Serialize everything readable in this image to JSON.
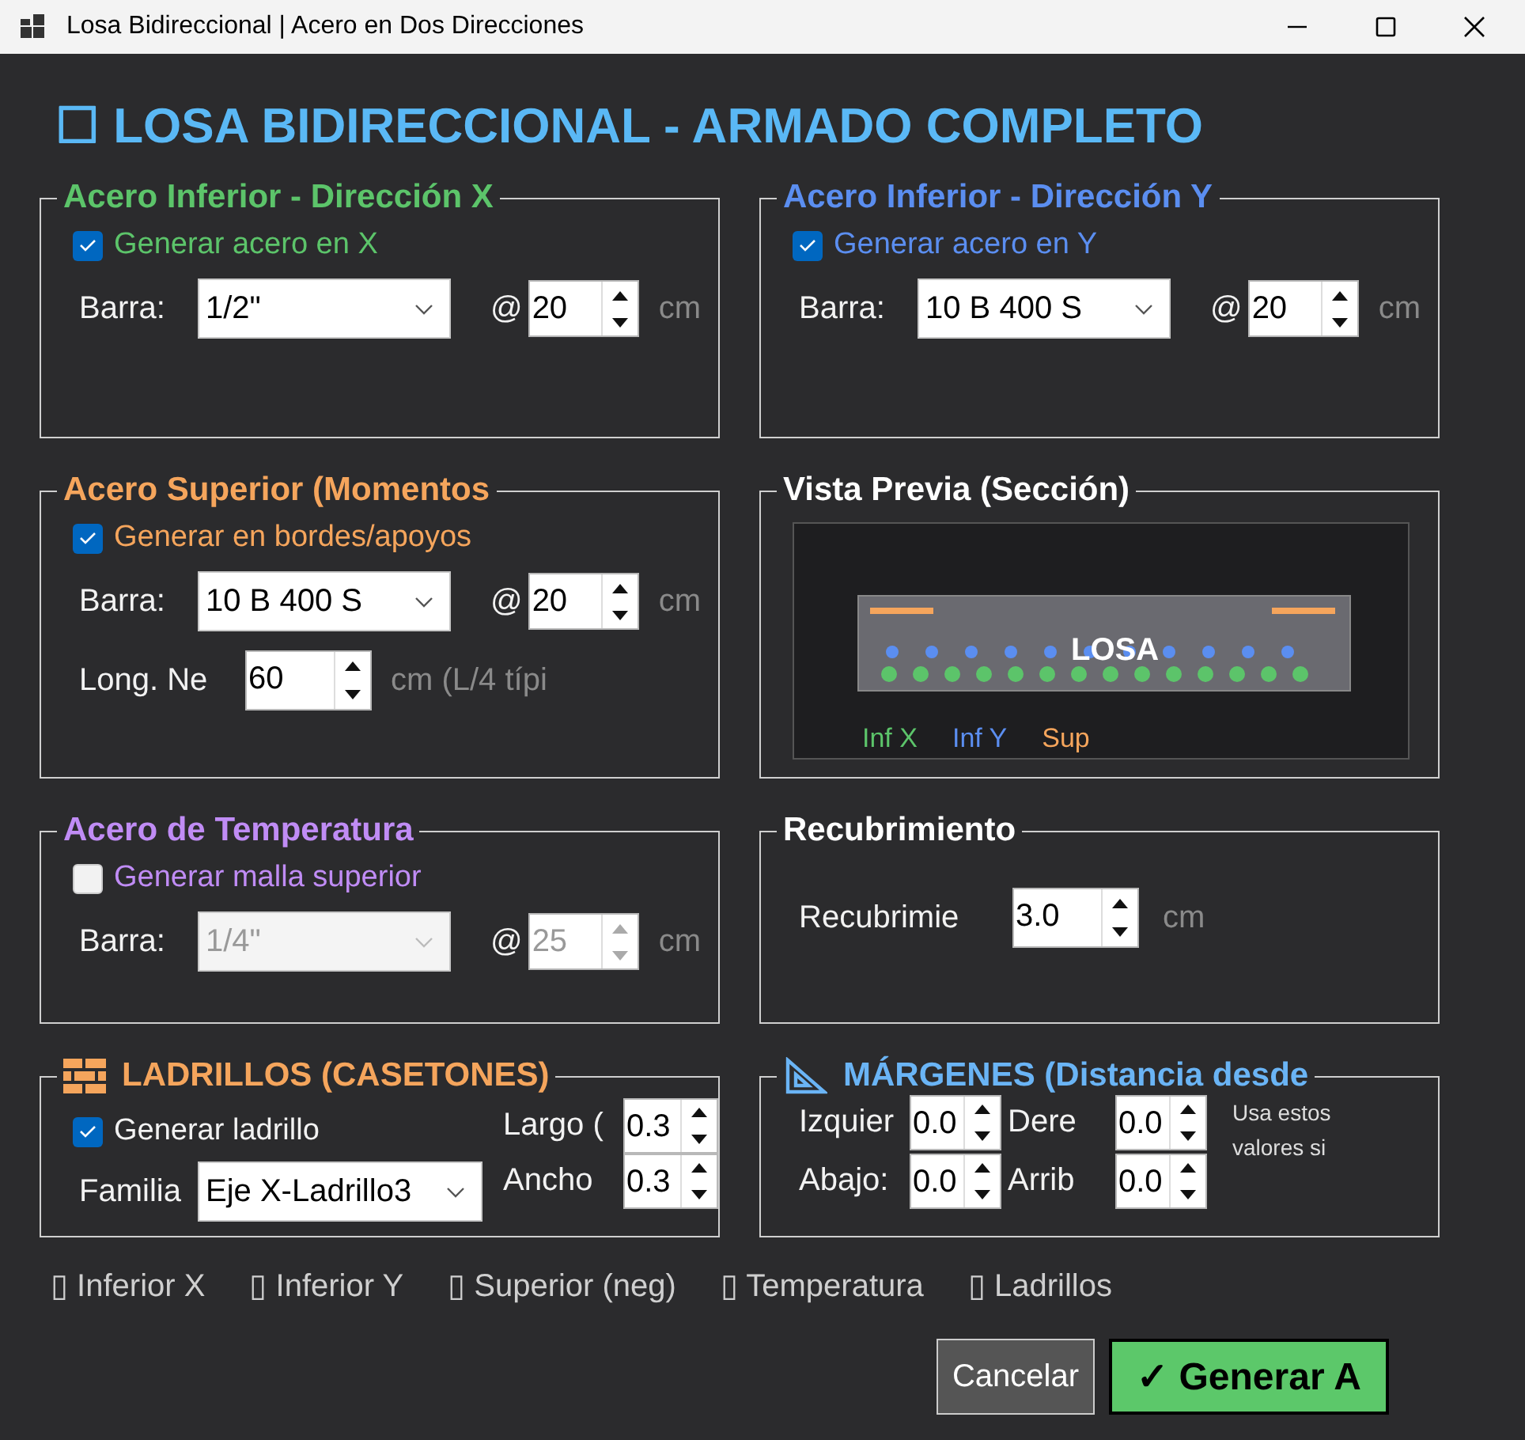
{
  "window": {
    "title": "Losa Bidireccional | Acero en Dos Direcciones"
  },
  "heading": "☐ LOSA BIDIRECCIONAL - ARMADO COMPLETO",
  "groups": [
    {
      "kind": "steel",
      "title": "Acero Inferior - Dirección X",
      "color": "#5cc46a",
      "checkbox": {
        "label": "Generar acero en X",
        "checked": true
      },
      "bar_label": "Barra:",
      "select": {
        "value": "1/2\"",
        "disabled": false
      },
      "at": "@",
      "spacing": {
        "value": "20",
        "disabled": false
      },
      "unit": "cm"
    },
    {
      "kind": "steel",
      "title": "Acero Inferior - Dirección Y",
      "color": "#5b8ef0",
      "checkbox": {
        "label": "Generar acero en Y",
        "checked": true
      },
      "bar_label": "Barra:",
      "select": {
        "value": "10 B 400 S",
        "disabled": false
      },
      "at": "@",
      "spacing": {
        "value": "20",
        "disabled": false
      },
      "unit": "cm"
    },
    {
      "kind": "steel",
      "title": "Acero Superior (Momentos",
      "color": "#f5a55c",
      "checkbox": {
        "label": "Generar en bordes/apoyos",
        "checked": true
      },
      "bar_label": "Barra:",
      "select": {
        "value": "10 B 400 S",
        "disabled": false
      },
      "at": "@",
      "spacing": {
        "value": "20",
        "disabled": false
      },
      "unit": "cm",
      "length": {
        "label": "Long. Ne",
        "value": "60",
        "unit": "cm (L/4 típi"
      }
    },
    {
      "kind": "preview",
      "title": "Vista Previa (Sección)",
      "color": "#ffffff",
      "slab_label": "LOSA",
      "legend": [
        {
          "label": "Inf X",
          "color": "#5cc46a"
        },
        {
          "label": "Inf Y",
          "color": "#5b8ef0"
        },
        {
          "label": "Sup",
          "color": "#f5a55c"
        }
      ]
    },
    {
      "kind": "steel",
      "title": "Acero de Temperatura",
      "color": "#c08cf5",
      "checkbox": {
        "label": "Generar malla superior",
        "checked": false
      },
      "bar_label": "Barra:",
      "select": {
        "value": "1/4\"",
        "disabled": true
      },
      "at": "@",
      "spacing": {
        "value": "25",
        "disabled": true
      },
      "unit": "cm"
    },
    {
      "kind": "cover",
      "title": "Recubrimiento",
      "color": "#ffffff",
      "label": "Recubrimie",
      "value": "3.0",
      "unit": "cm"
    },
    {
      "kind": "bricks",
      "title": "LADRILLOS (CASETONES)",
      "color": "#f5a55c",
      "checkbox": {
        "label": "Generar ladrillo",
        "checked": true
      },
      "family_label": "Familia",
      "family": "Eje X-Ladrillo3",
      "fields": [
        {
          "label": "Largo (",
          "value": "0.3"
        },
        {
          "label": "Ancho",
          "value": "0.3"
        }
      ]
    },
    {
      "kind": "margins",
      "title": "MÁRGENES (Distancia desde",
      "color": "#6ab4f5",
      "fields": [
        {
          "label": "Izquier",
          "value": "0.0"
        },
        {
          "label": "Dere",
          "value": "0.0"
        },
        {
          "label": "Abajo:",
          "value": "0.0"
        },
        {
          "label": "Arrib",
          "value": "0.0"
        }
      ],
      "note": "Usa estos valores si"
    }
  ],
  "legend": [
    "▯ Inferior X",
    "▯ Inferior Y",
    "▯ Superior (neg)",
    "▯ Temperatura",
    "▯ Ladrillos"
  ],
  "buttons": [
    {
      "kind": "cancel",
      "label": "Cancelar"
    },
    {
      "kind": "primary",
      "label": "✓ Generar A"
    }
  ]
}
